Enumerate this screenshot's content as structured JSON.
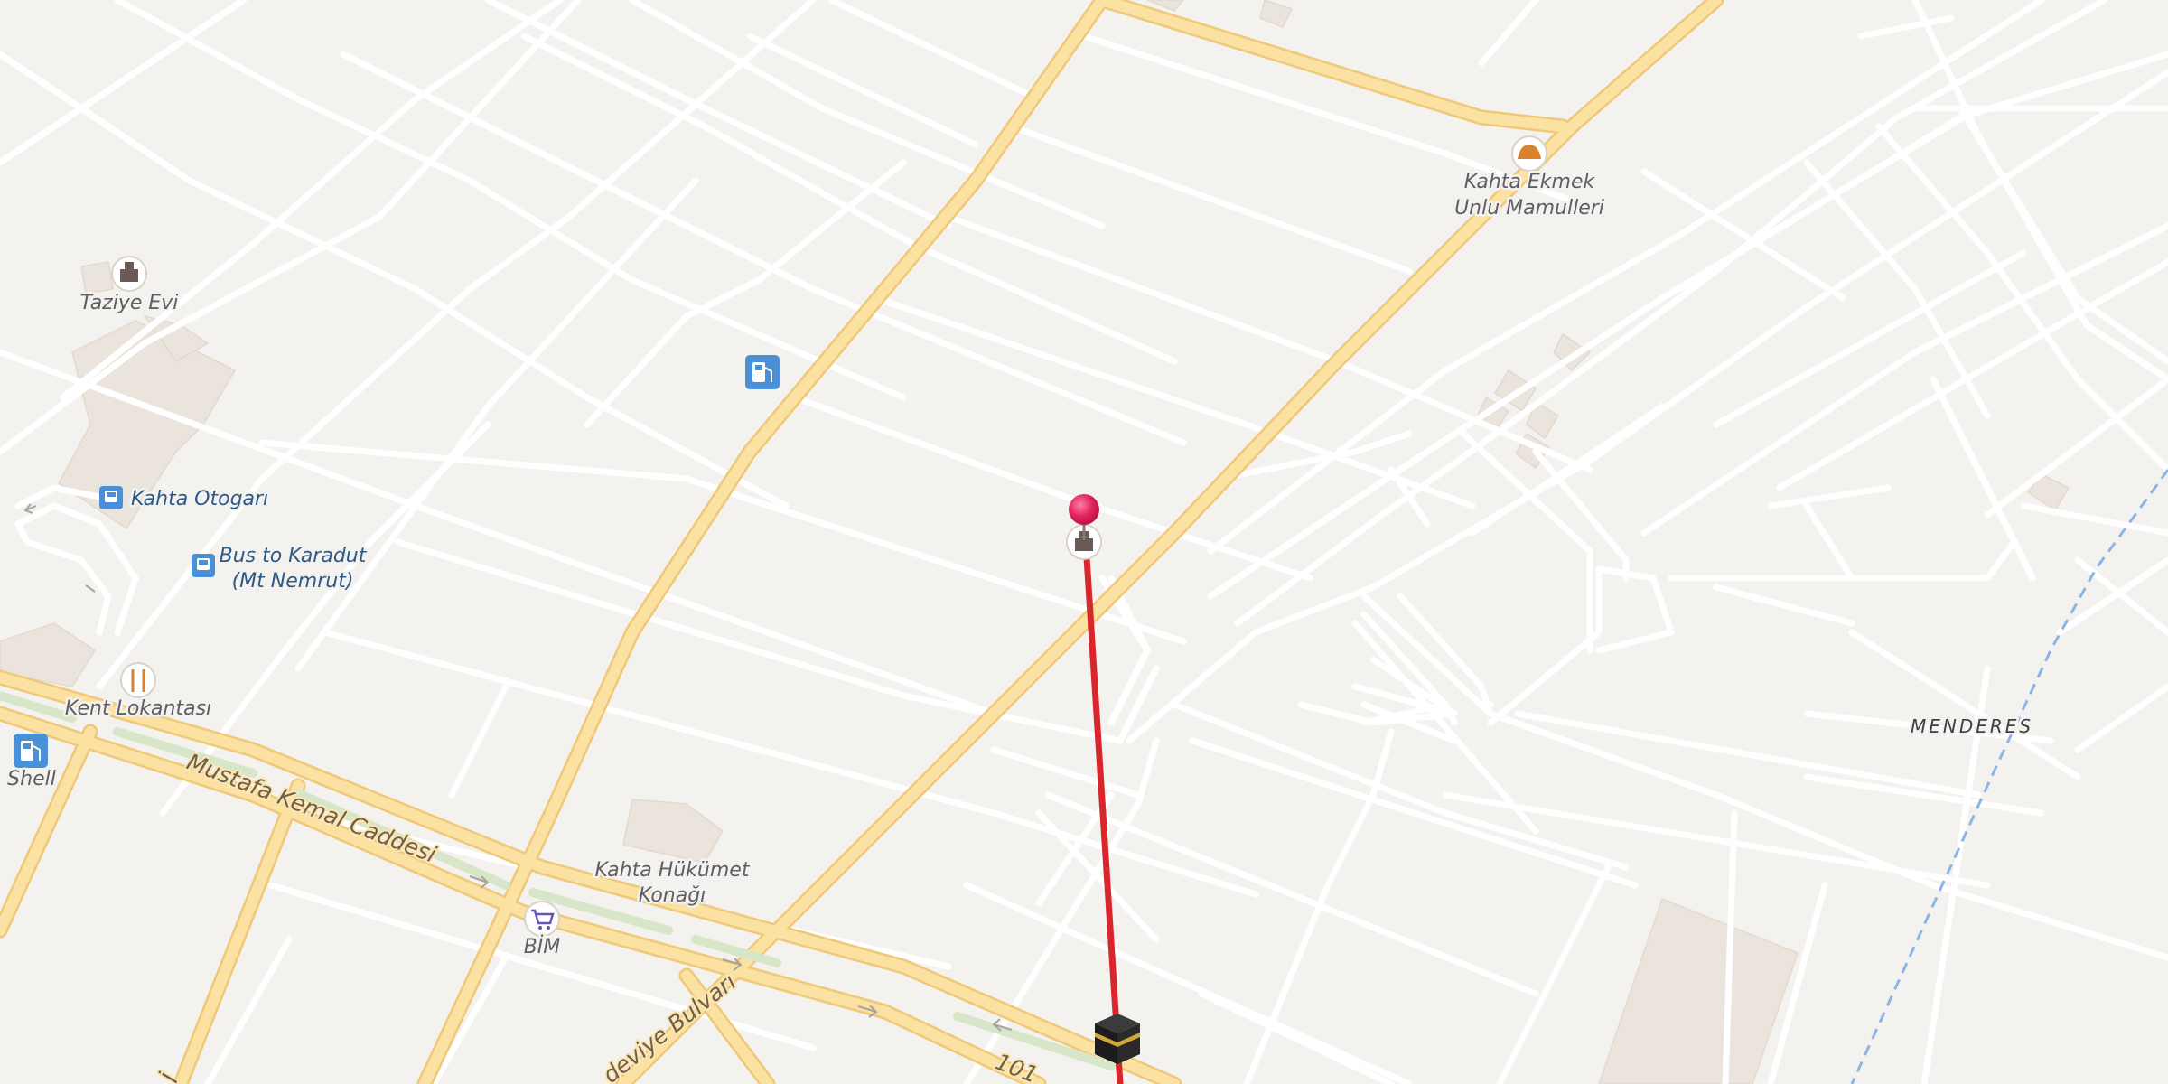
{
  "map": {
    "roads": {
      "mustafa_kemal": "Mustafa Kemal Caddesi",
      "bulvari": "deviye Bulvarı",
      "route_number": "101",
      "partial_left": "İ"
    },
    "district": "MENDERES",
    "pois": [
      {
        "id": "taziye-evi",
        "label": "Taziye Evi",
        "type": "building",
        "icon": "building-icon"
      },
      {
        "id": "kahta-otogari",
        "label": "Kahta Otogarı",
        "type": "bus",
        "icon": "bus-icon"
      },
      {
        "id": "bus-karadut",
        "label": "Bus to Karadut",
        "label2": "(Mt Nemrut)",
        "type": "bus",
        "icon": "bus-icon"
      },
      {
        "id": "kent-lokantasi",
        "label": "Kent Lokantası",
        "type": "restaurant",
        "icon": "fork-knife-icon"
      },
      {
        "id": "shell",
        "label": "Shell",
        "type": "fuel",
        "icon": "fuel-icon"
      },
      {
        "id": "kahta-hukumet",
        "label": "Kahta Hükümet",
        "label2": "Konağı",
        "type": "landmark"
      },
      {
        "id": "bim",
        "label": "BİM",
        "type": "shop",
        "icon": "cart-icon"
      },
      {
        "id": "kahta-ekmek",
        "label": "Kahta Ekmek",
        "label2": "Unlu Mamulleri",
        "type": "bakery",
        "icon": "bakery-icon"
      },
      {
        "id": "fuel-center",
        "label": "",
        "type": "fuel",
        "icon": "fuel-icon"
      },
      {
        "id": "mosque-pin",
        "label": "",
        "type": "building",
        "icon": "building-icon"
      }
    ],
    "markers": {
      "pin": "pin-marker",
      "destination": "kaaba-icon",
      "route_line_color": "#d9262c"
    },
    "colors": {
      "background": "#f4f2ef",
      "road_minor": "#ffffff",
      "road_major": "#fbe1a2",
      "road_major_casing": "#efc878",
      "median": "#d7e6c8",
      "building": "#ebe4dc",
      "poi_blue": "#4a90d9",
      "pin": "#e0245e",
      "water_dash": "#8db4e6"
    }
  }
}
